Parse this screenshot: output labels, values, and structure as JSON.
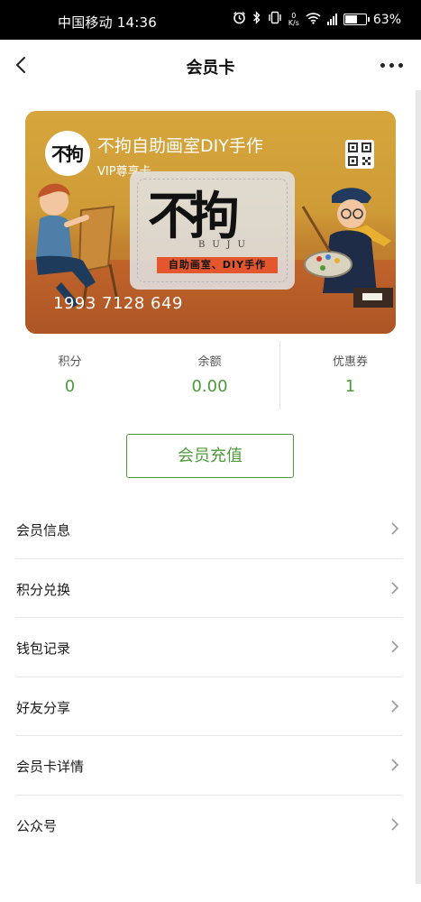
{
  "status_bar": {
    "carrier_time": "中国移动 14:36",
    "speed_value": "0",
    "speed_unit": "K/s",
    "battery_percent": "63%",
    "battery_level": 0.63,
    "icons": [
      "alarm-icon",
      "bluetooth-icon",
      "vibrate-icon",
      "wifi-icon",
      "4g-signal-icon",
      "battery-icon"
    ]
  },
  "nav": {
    "title": "会员卡",
    "back_icon": "chevron-left-icon",
    "more_icon": "more-dots-icon"
  },
  "card": {
    "logo_text": "不拘",
    "name": "不拘自助画室DIY手作",
    "level": "VIP尊享卡",
    "brand_big": "不拘",
    "brand_pinyin": "BUJU",
    "brand_strip": "自助画室、DIY手作",
    "number": "1993 7128 649",
    "qr_icon": "qr-code-icon",
    "colors": {
      "top": "#d6a63c",
      "bottom": "#ad5526",
      "strip": "#e4572e"
    }
  },
  "stats": [
    {
      "label": "积分",
      "value": "0"
    },
    {
      "label": "余额",
      "value": "0.00"
    },
    {
      "label": "优惠券",
      "value": "1"
    }
  ],
  "recharge_button": "会员充值",
  "menu": [
    {
      "label": "会员信息"
    },
    {
      "label": "积分兑换"
    },
    {
      "label": "钱包记录"
    },
    {
      "label": "好友分享"
    },
    {
      "label": "会员卡详情"
    },
    {
      "label": "公众号"
    }
  ],
  "colors": {
    "accent_green": "#4e9a3a",
    "status_bar": "#000000"
  }
}
